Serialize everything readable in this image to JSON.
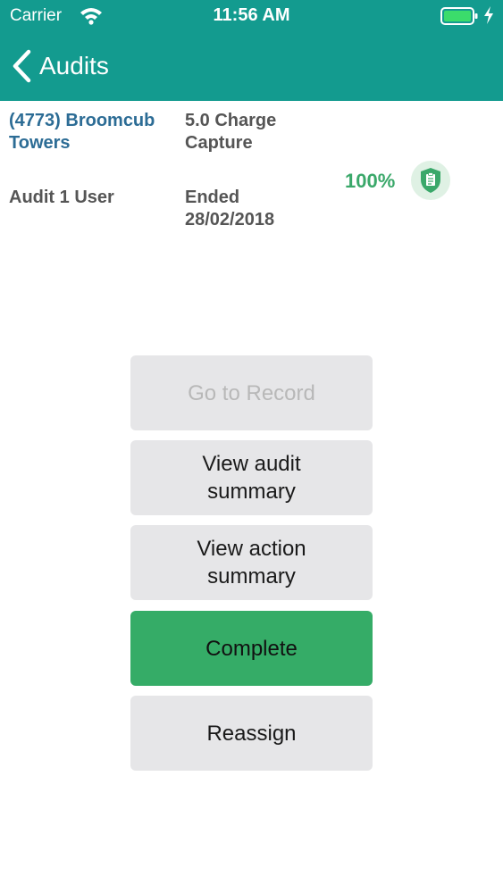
{
  "status_bar": {
    "carrier": "Carrier",
    "time": "11:56 AM"
  },
  "nav": {
    "back_label": "Audits"
  },
  "audit": {
    "site": "(4773) Broomcub Towers",
    "type": "5.0 Charge Capture",
    "user": "Audit 1 User",
    "status": "Ended 28/02/2018",
    "score": "100%"
  },
  "buttons": {
    "go_to_record": "Go to Record",
    "view_audit_summary": "View audit summary",
    "view_action_summary": "View action summary",
    "complete": "Complete",
    "reassign": "Reassign"
  },
  "colors": {
    "header_teal": "#139b8f",
    "link_blue": "#2c6c95",
    "score_green": "#3aa86a",
    "complete_green": "#35ac67",
    "button_gray": "#e6e6e8"
  },
  "icons": {
    "back": "chevron-left-icon",
    "badge": "shield-clipboard-icon"
  }
}
